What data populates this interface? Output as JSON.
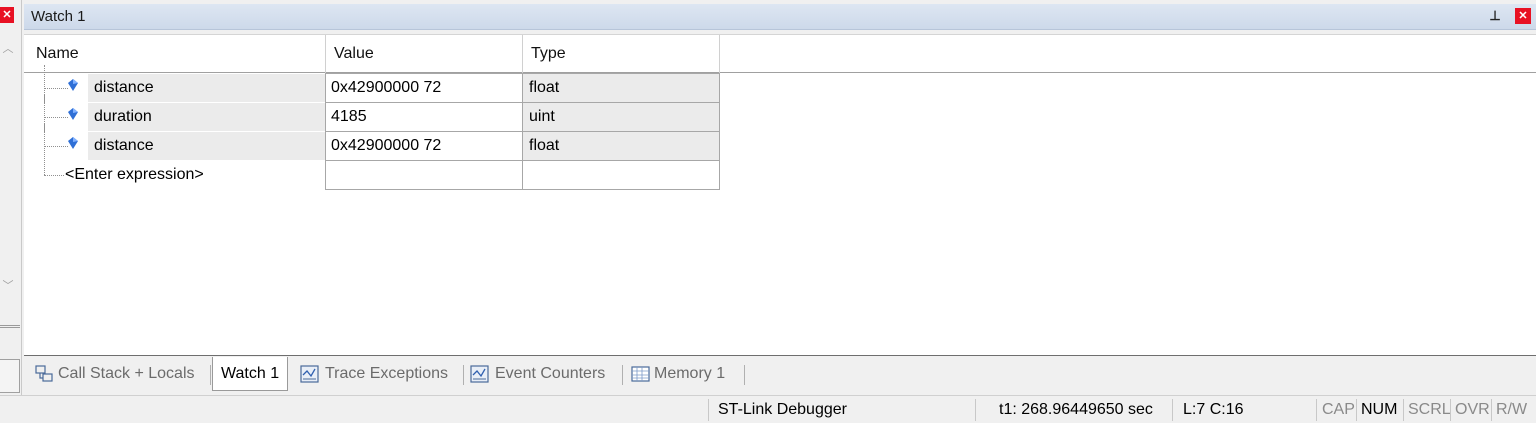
{
  "window": {
    "title": "Watch 1"
  },
  "table": {
    "headers": {
      "name": "Name",
      "value": "Value",
      "type": "Type"
    },
    "rows": [
      {
        "name": "distance",
        "value": "0x42900000  72",
        "type": "float"
      },
      {
        "name": "duration",
        "value": "4185",
        "type": "uint"
      },
      {
        "name": "distance",
        "value": "0x42900000  72",
        "type": "float"
      }
    ],
    "enter_expression": "<Enter expression>"
  },
  "tabs": [
    {
      "label": "Call Stack + Locals",
      "icon": "call-stack-icon"
    },
    {
      "label": "Watch 1",
      "active": true
    },
    {
      "label": "Trace Exceptions",
      "icon": "trace-icon"
    },
    {
      "label": "Event Counters",
      "icon": "counter-icon"
    },
    {
      "label": "Memory 1",
      "icon": "memory-icon"
    }
  ],
  "status": {
    "debugger": "ST-Link Debugger",
    "time": "t1: 268.96449650 sec",
    "position": "L:7 C:16",
    "cap": "CAP",
    "num": "NUM",
    "scrl": "SCRL",
    "ovr": "OVR",
    "rw": "R/W"
  },
  "colors": {
    "accent_close": "#e81123",
    "titlebar": "#d4deed",
    "gem": "#2f6fd6"
  }
}
